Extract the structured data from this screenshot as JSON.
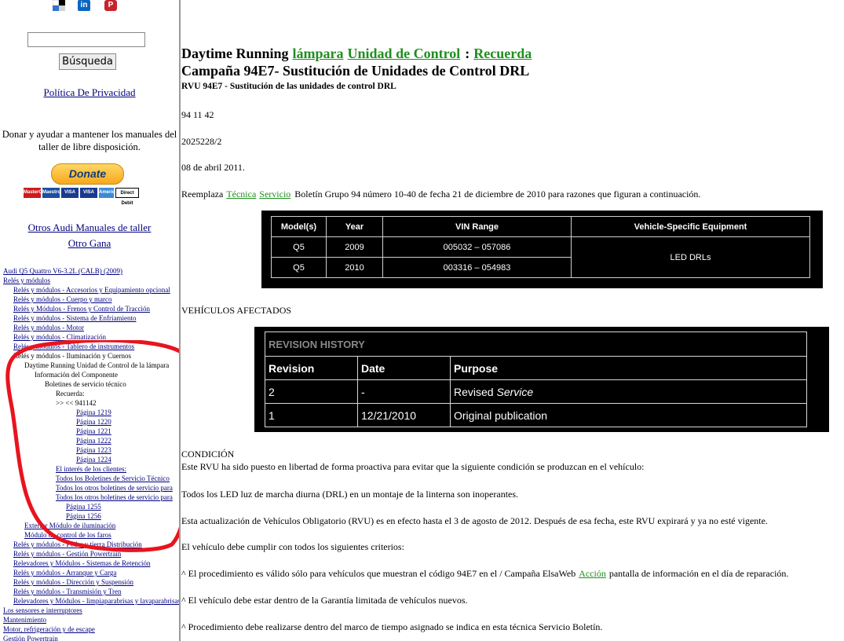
{
  "sidebar": {
    "social_icons": [
      "delicious-icon",
      "linkedin-icon",
      "pinterest-icon"
    ],
    "social_glyphs": {
      "linkedin": "in",
      "pinterest": "P"
    },
    "search": {
      "value": "",
      "button_label": "Búsqueda"
    },
    "privacy_link": "Política De Privacidad",
    "donate_text": "Donar y ayudar a mantener los manuales del taller de libre disposición.",
    "donate_button": "Donate",
    "payment_cards": [
      "MasterCard",
      "Maestro",
      "VISA",
      "VISA Electron",
      "American Express",
      "Direct Debit"
    ],
    "other_manuals_link": "Otros Audi Manuales de taller",
    "other_gana_link": "Otro Gana",
    "tree": [
      {
        "level": 0,
        "text": "Audi Q5 Quattro V6-3.2L (CALB) (2009)",
        "link": true
      },
      {
        "level": 0,
        "text": "Relés y módulos",
        "link": true
      },
      {
        "level": 1,
        "text": "Relés y módulos - Accesorios y Equipamiento opcional",
        "link": true
      },
      {
        "level": 1,
        "text": "Relés y módulos - Cuerpo y marco",
        "link": true
      },
      {
        "level": 1,
        "text": "Relés y Módulos - Frenos y Control de Tracción",
        "link": true
      },
      {
        "level": 1,
        "text": "Relés y módulos - Sistema de Enfriamiento",
        "link": true
      },
      {
        "level": 1,
        "text": "Relés y módulos - Motor",
        "link": true
      },
      {
        "level": 1,
        "text": "Relés y módulos - Climatización",
        "link": true
      },
      {
        "level": 1,
        "text": "Relés y módulos - Tablero de instrumentos",
        "link": true
      },
      {
        "level": 1,
        "text": "Relés y módulos - Iluminación y Cuernos",
        "link": false
      },
      {
        "level": 2,
        "text": "Daytime Running Unidad de Control de la lámpara",
        "link": false
      },
      {
        "level": 3,
        "text": "Información del Componente",
        "link": false
      },
      {
        "level": 4,
        "text": "Boletines de servicio técnico",
        "link": false
      },
      {
        "level": 5,
        "text": "Recuerda:",
        "link": false
      },
      {
        "level": 5,
        "text": ">> << 941142",
        "link": false
      },
      {
        "level": 7,
        "text": "Página 1219",
        "link": true
      },
      {
        "level": 7,
        "text": "Página 1220",
        "link": true
      },
      {
        "level": 7,
        "text": "Página 1221",
        "link": true
      },
      {
        "level": 7,
        "text": "Página 1222",
        "link": true
      },
      {
        "level": 7,
        "text": "Página 1223",
        "link": true
      },
      {
        "level": 7,
        "text": "Página 1224",
        "link": true
      },
      {
        "level": 5,
        "text": "El interés de los clientes:",
        "link": true
      },
      {
        "level": 5,
        "text": "Todos los Boletines de Servicio Técnico",
        "link": true
      },
      {
        "level": 5,
        "text": "Todos los otros boletines de servicio para",
        "link": true
      },
      {
        "level": 5,
        "text": "Todos los otros boletines de servicio para",
        "link": true
      },
      {
        "level": 6,
        "text": "Página 1255",
        "link": true
      },
      {
        "level": 6,
        "text": "Página 1256",
        "link": true
      },
      {
        "level": 2,
        "text": "Exterior Módulo de iluminación",
        "link": true
      },
      {
        "level": 2,
        "text": "Módulo de control de los faros",
        "link": true
      },
      {
        "level": 1,
        "text": "Relés y módulos - Poder y tierra Distribución",
        "link": true
      },
      {
        "level": 1,
        "text": "Relés y módulos - Gestión Powertrain",
        "link": true
      },
      {
        "level": 1,
        "text": "Relevadores y Módulos - Sistemas de Retención",
        "link": true
      },
      {
        "level": 1,
        "text": "Relés y módulos - Arranque y Carga",
        "link": true
      },
      {
        "level": 1,
        "text": "Relés y módulos - Dirección y Suspensión",
        "link": true
      },
      {
        "level": 1,
        "text": "Relés y módulos - Transmisión y Tren",
        "link": true
      },
      {
        "level": 1,
        "text": "Relevadores y Módulos - limpiaparabrisas y lavaparabrisas",
        "link": true
      },
      {
        "level": 0,
        "text": "Los sensores e interruptores",
        "link": true
      },
      {
        "level": 0,
        "text": "Mantenimiento",
        "link": true
      },
      {
        "level": 0,
        "text": "Motor, refrigeración y de escape",
        "link": true
      },
      {
        "level": 0,
        "text": "Gestión Powertrain",
        "link": true
      }
    ]
  },
  "main": {
    "heading_prefix": "Daytime Running",
    "heading_links": [
      "lámpara",
      "Unidad de Control"
    ],
    "heading_colon": ":",
    "heading_link_last": "Recuerda",
    "title": "Campaña 94E7- Sustitución de Unidades de Control DRL",
    "subtitle": "RVU 94E7 - Sustitución de las unidades de control DRL",
    "ref1": "94 11 42",
    "ref2": "2025228/2",
    "date": "08 de abril 2011.",
    "replaces_prefix": "Reemplaza",
    "replaces_link1": "Técnica",
    "replaces_link2": "Servicio",
    "replaces_suffix": "Boletín Grupo 94 número 10-40 de fecha 21 de diciembre de 2010 para razones que figuran a continuación.",
    "vehicle_table": {
      "headers": [
        "Model(s)",
        "Year",
        "VIN Range",
        "Vehicle-Specific Equipment"
      ],
      "rows": [
        {
          "model": "Q5",
          "year": "2009",
          "vin": "005032 – 057086"
        },
        {
          "model": "Q5",
          "year": "2010",
          "vin": "003316 – 054983"
        }
      ],
      "equipment": "LED DRLs"
    },
    "affected_label": "VEHÍCULOS AFECTADOS",
    "revision_table": {
      "title": "REVISION HISTORY",
      "headers": [
        "Revision",
        "Date",
        "Purpose"
      ],
      "rows": [
        {
          "revision": "2",
          "date": "-",
          "purpose_prefix": "Revised",
          "purpose_italic": "Service"
        },
        {
          "revision": "1",
          "date": "12/21/2010",
          "purpose_prefix": "Original publication",
          "purpose_italic": ""
        }
      ]
    },
    "condition_label": "CONDICIÓN",
    "condition_text": "Este RVU ha sido puesto en libertad de forma proactiva para evitar que la siguiente condición se produzcan en el vehículo:",
    "led_text": "Todos los LED luz de marcha diurna (DRL) en un montaje de la linterna son inoperantes.",
    "rvu_text": "Esta actualización de Vehículos Obligatorio (RVU) es en efecto hasta el 3 de agosto de 2012. Después de esa fecha, este RVU expirará y ya no esté vigente.",
    "criteria_text": "El vehículo debe cumplir con todos los siguientes criterios:",
    "criteria1_prefix": "^ El procedimiento es válido sólo para vehículos que muestran el código 94E7 en el / Campaña ElsaWeb",
    "criteria1_link": "Acción",
    "criteria1_suffix": "pantalla de información en el día de reparación.",
    "criteria2": "^ El vehículo debe estar dentro de la Garantía limitada de vehículos nuevos.",
    "criteria3": "^ Procedimiento debe realizarse dentro del marco de tiempo asignado se indica en esta  técnica  Servicio  Boletín."
  },
  "colors": {
    "annotation": "#e8141e",
    "link_green": "#1e8f1e",
    "link_blue": "#00007f"
  }
}
